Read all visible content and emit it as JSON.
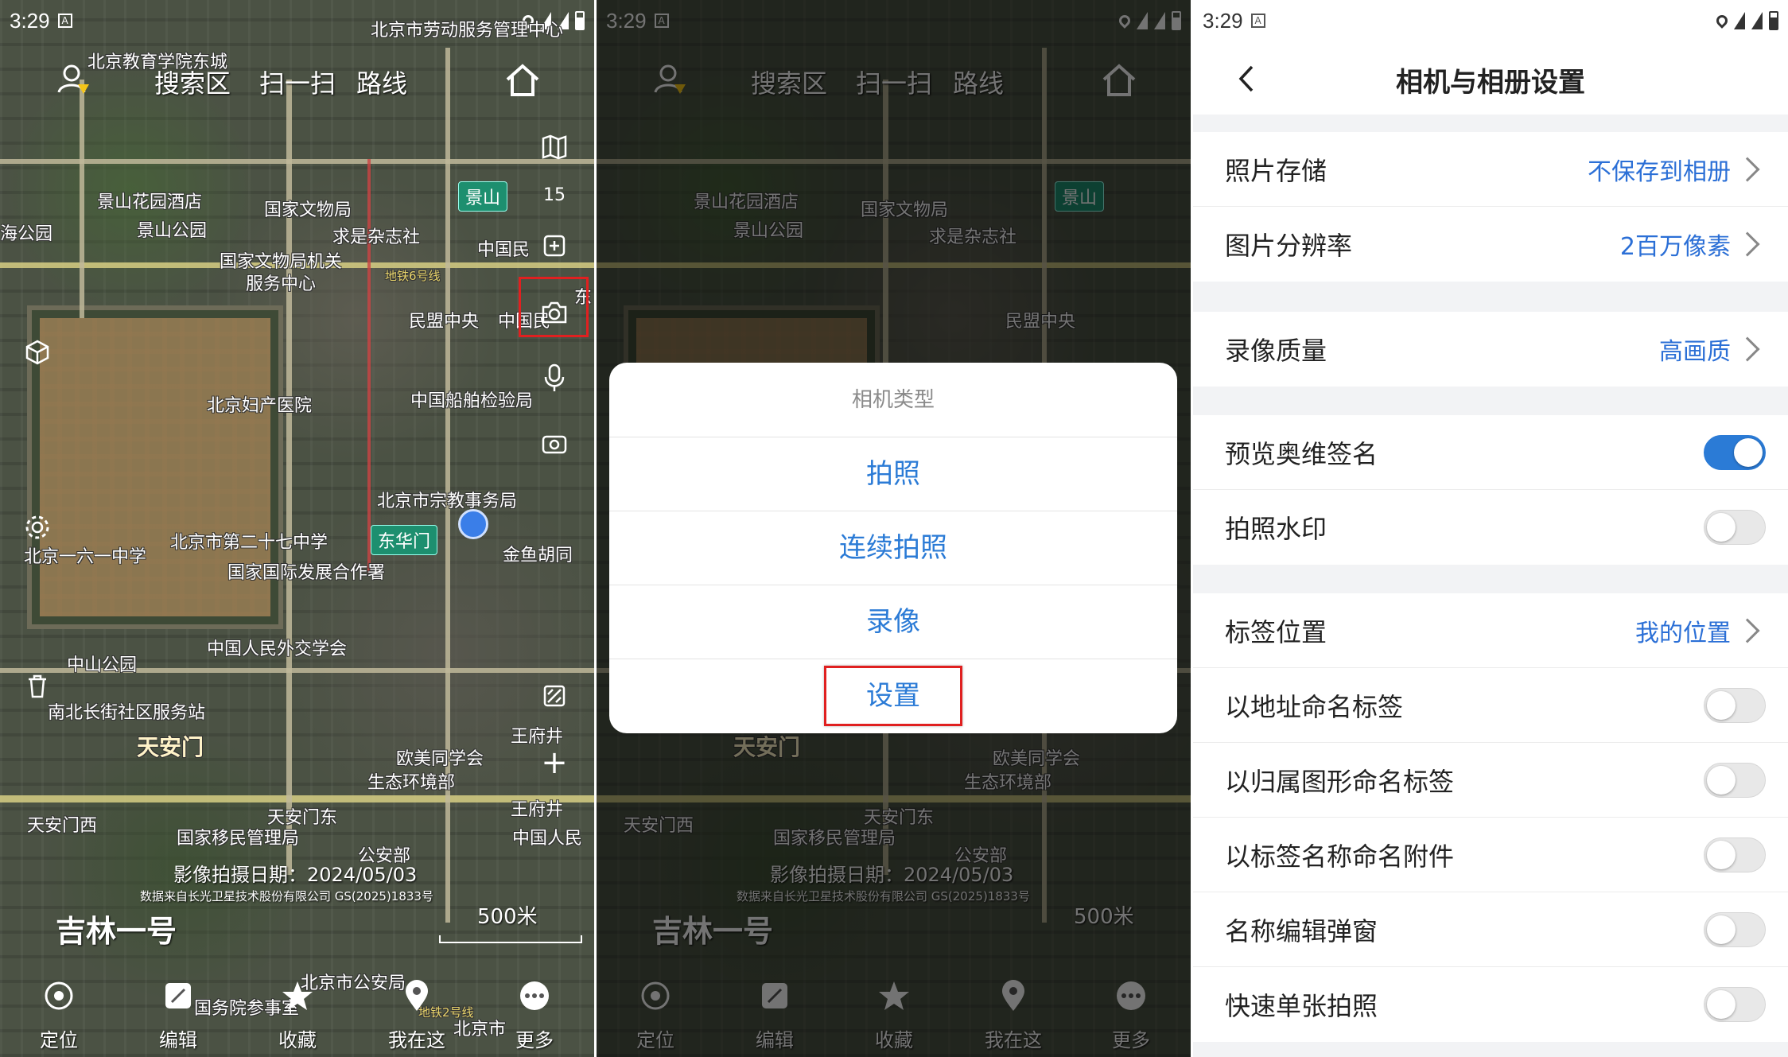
{
  "status": {
    "time": "3:29"
  },
  "map": {
    "nav": {
      "search": "搜索区",
      "scan": "扫一扫",
      "route": "路线"
    },
    "zoom_level": "15",
    "scale": "500米",
    "capture_date": "影像拍摄日期：2024/05/03",
    "data_source": "数据来自长光卫星技术股份有限公司 GS(2025)1833号",
    "brand": "吉林一号",
    "labels": {
      "jingshan": "景山",
      "jingshan_hotel": "景山花园酒店",
      "jingshan_park": "景山公园",
      "cultural_bureau": "国家文物局",
      "qiushi": "求是杂志社",
      "cultural_bureau_service": "国家文物局机关服务中心",
      "minmeng": "民盟中央",
      "fuchan_hospital": "北京妇产医院",
      "ship_inspection": "中国船舶检验局",
      "religious_affairs": "北京市宗教事务局",
      "school27": "北京市第二十七中学",
      "donghuamen": "东华门",
      "jinyu_hutong": "金鱼胡同",
      "intl_dev": "国家国际发展合作署",
      "beijing161": "北京一六一中学",
      "zhongshan_park": "中山公园",
      "diplomacy_society": "中国人民外交学会",
      "nanbeichang": "南北长街社区服务站",
      "tiananmen": "天安门",
      "oumei": "欧美同学会",
      "eco_env": "生态环境部",
      "wangfujing": "王府井",
      "tiananmen_west": "天安门西",
      "tiananmen_east": "天安门东",
      "immigration": "国家移民管理局",
      "public_security": "公安部",
      "edu_school": "北京教育学院东城",
      "labor_service": "北京市劳动服务管理中心",
      "beijing_city_police": "北京市公安局",
      "state_council": "国务院参事室",
      "beijing_museum": "北京市",
      "people": "中国人民",
      "guomin": "中国民",
      "beihai": "海公园",
      "dong": "东",
      "line6": "地铁6号线",
      "line2": "地铁2号线"
    },
    "tabs": [
      {
        "label": "定位",
        "icon": "locate-icon"
      },
      {
        "label": "编辑",
        "icon": "edit-icon"
      },
      {
        "label": "收藏",
        "icon": "star-icon"
      },
      {
        "label": "我在这",
        "icon": "pin-icon"
      },
      {
        "label": "更多",
        "icon": "more-icon"
      }
    ]
  },
  "dialog": {
    "title": "相机类型",
    "items": [
      "拍照",
      "连续拍照",
      "录像",
      "设置"
    ]
  },
  "settings": {
    "title": "相机与相册设置",
    "groups": [
      [
        {
          "label": "照片存储",
          "value": "不保存到相册"
        },
        {
          "label": "图片分辨率",
          "value": "2百万像素"
        }
      ],
      [
        {
          "label": "录像质量",
          "value": "高画质"
        }
      ],
      [
        {
          "label": "预览奥维签名",
          "toggle": true
        },
        {
          "label": "拍照水印",
          "toggle": false
        }
      ],
      [
        {
          "label": "标签位置",
          "value": "我的位置"
        },
        {
          "label": "以地址命名标签",
          "toggle": false
        },
        {
          "label": "以归属图形命名标签",
          "toggle": false
        },
        {
          "label": "以标签名称命名附件",
          "toggle": false
        },
        {
          "label": "名称编辑弹窗",
          "toggle": false
        },
        {
          "label": "快速单张拍照",
          "toggle": false
        }
      ]
    ]
  },
  "colors": {
    "accent": "#2b7bd6",
    "highlight_box": "#e02020",
    "settings_bg": "#f2f3f5"
  }
}
